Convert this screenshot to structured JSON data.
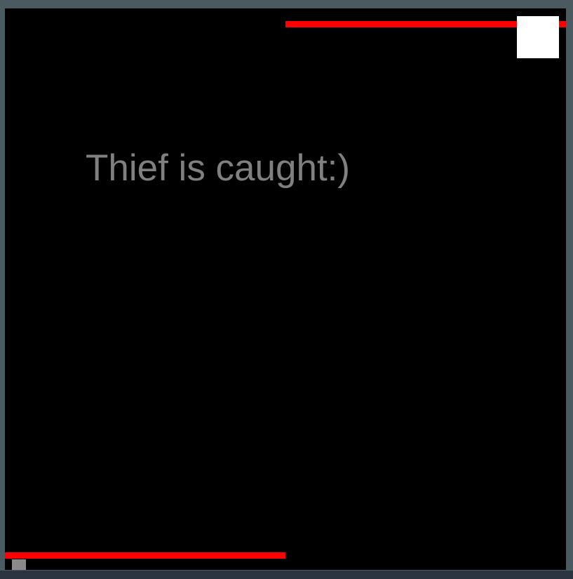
{
  "game": {
    "status_message": "Thief is caught:)"
  },
  "colors": {
    "page_border": "#4b5960",
    "canvas_background": "#000000",
    "wall": "#ff0000",
    "player": "#ffffff",
    "thief": "#8a8a8a",
    "message_text": "#808080"
  }
}
